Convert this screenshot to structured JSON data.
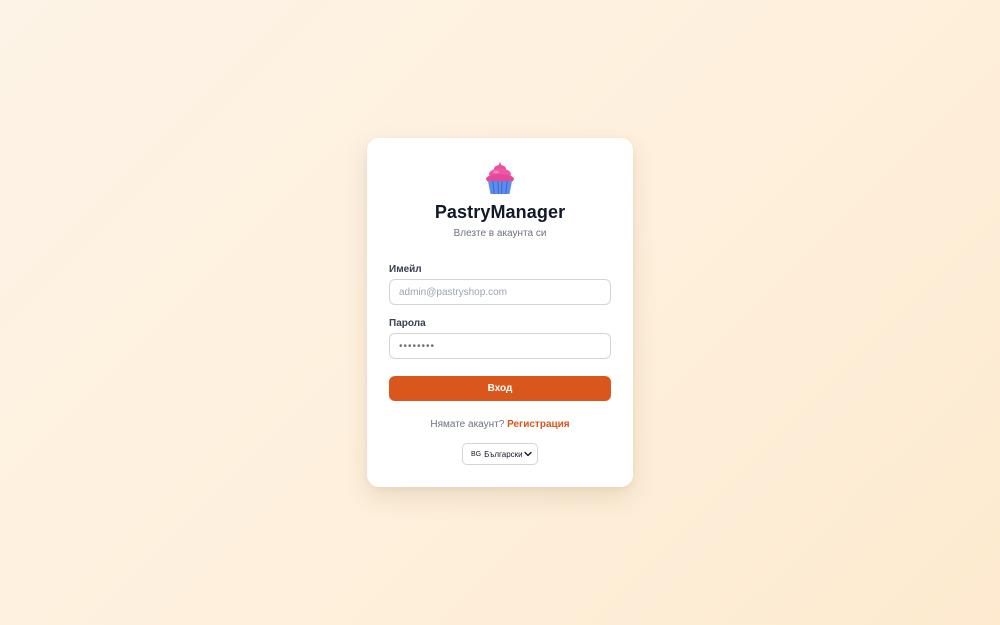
{
  "app": {
    "title": "PastryManager",
    "subtitle": "Влезте в акаунта си",
    "logo_icon": "cupcake-icon"
  },
  "form": {
    "email_label": "Имейл",
    "email_placeholder": "admin@pastryshop.com",
    "email_value": "",
    "password_label": "Парола",
    "password_placeholder": "••••••••",
    "password_value": "",
    "submit_label": "Вход"
  },
  "register": {
    "prompt": "Нямате акаунт?",
    "link_label": "Регистрация"
  },
  "language": {
    "flag": "BG",
    "selected": "Български"
  },
  "colors": {
    "accent": "#d9561d",
    "background": "#fdf3e6",
    "card": "#ffffff"
  }
}
